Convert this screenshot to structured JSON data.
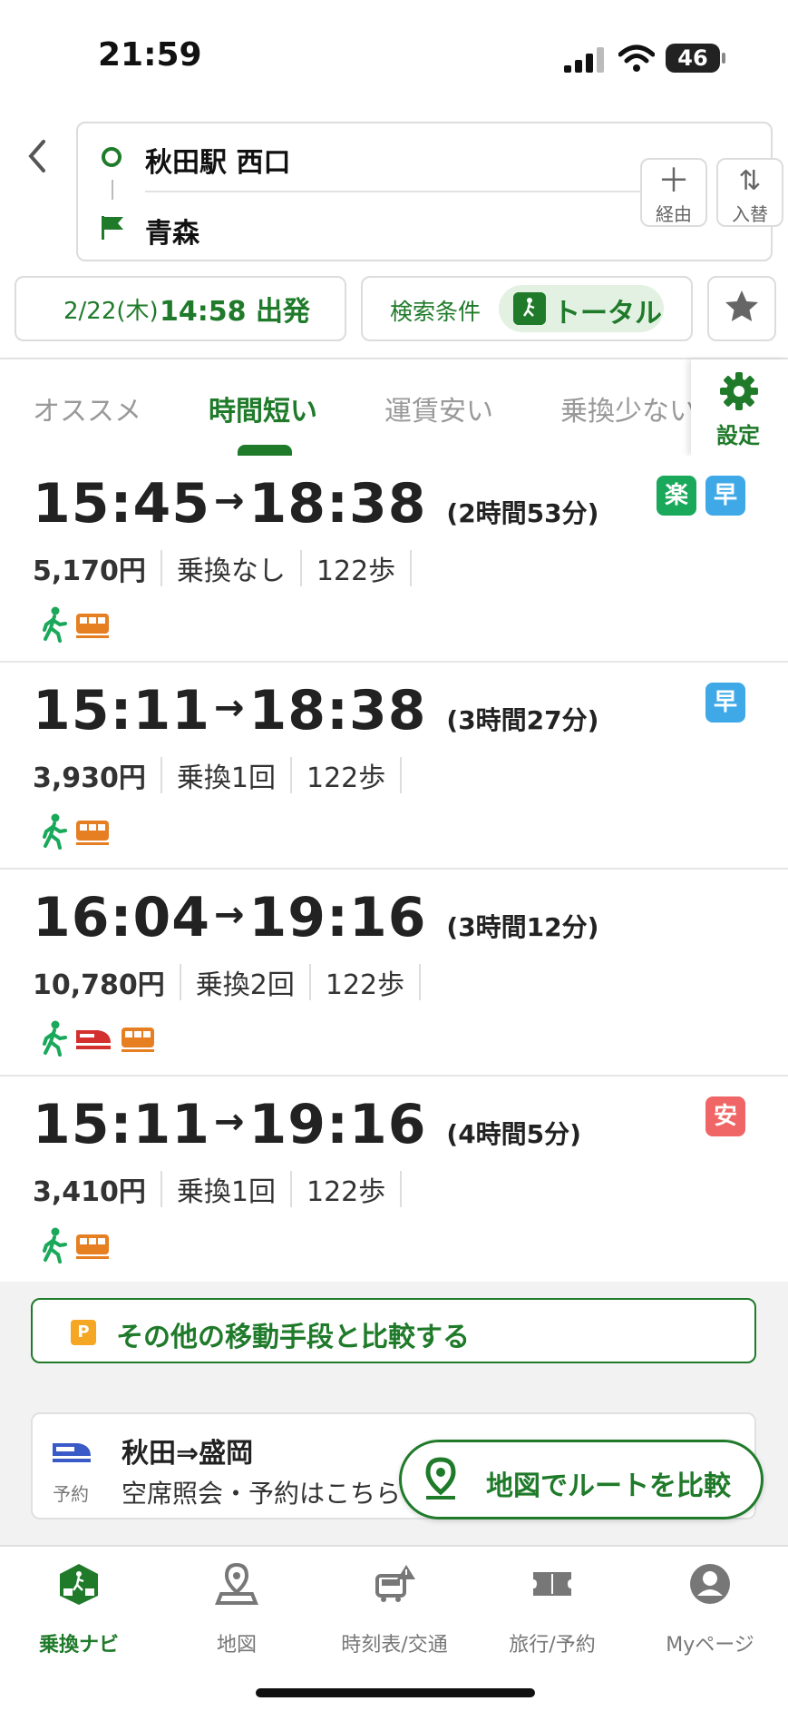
{
  "status_bar": {
    "time": "21:59",
    "battery": "46"
  },
  "route": {
    "origin": "秋田駅 西口",
    "destination": "青森"
  },
  "buttons": {
    "via": "経由",
    "swap": "入替"
  },
  "search": {
    "date": "2/22(木)",
    "time": "14:58 出発",
    "condition_label": "検索条件",
    "condition_value": "トータル"
  },
  "tabs": [
    {
      "label": "オススメ",
      "active": false
    },
    {
      "label": "時間短い",
      "active": true
    },
    {
      "label": "運賃安い",
      "active": false
    },
    {
      "label": "乗換少ない",
      "active": false
    }
  ],
  "settings_label": "設定",
  "routes": [
    {
      "depart": "15:45",
      "arrive": "18:38",
      "duration": "(2時間53分)",
      "fare": "5,170円",
      "transfers": "乗換なし",
      "walk": "122歩",
      "badges": [
        "楽",
        "早"
      ],
      "modes": [
        "walk",
        "train"
      ]
    },
    {
      "depart": "15:11",
      "arrive": "18:38",
      "duration": "(3時間27分)",
      "fare": "3,930円",
      "transfers": "乗換1回",
      "walk": "122歩",
      "badges": [
        "早"
      ],
      "modes": [
        "walk",
        "train"
      ]
    },
    {
      "depart": "16:04",
      "arrive": "19:16",
      "duration": "(3時間12分)",
      "fare": "10,780円",
      "transfers": "乗換2回",
      "walk": "122歩",
      "badges": [],
      "modes": [
        "walk",
        "shinkansen",
        "train"
      ]
    },
    {
      "depart": "15:11",
      "arrive": "19:16",
      "duration": "(4時間5分)",
      "fare": "3,410円",
      "transfers": "乗換1回",
      "walk": "122歩",
      "badges": [
        "安"
      ],
      "modes": [
        "walk",
        "train"
      ]
    }
  ],
  "compare": {
    "mark": "P",
    "label": "その他の移動手段と比較する"
  },
  "ad": {
    "tag": "予約",
    "title": "秋田⇒盛岡",
    "subtitle": "空席照会・予約はこちら"
  },
  "map_compare": "地図でルートを比較",
  "bottom_nav": [
    {
      "label": "乗換ナビ",
      "icon": "transit-nav-icon",
      "active": true
    },
    {
      "label": "地図",
      "icon": "map-icon",
      "active": false
    },
    {
      "label": "時刻表/交通",
      "icon": "timetable-icon",
      "active": false
    },
    {
      "label": "旅行/予約",
      "icon": "ticket-icon",
      "active": false
    },
    {
      "label": "Myページ",
      "icon": "person-icon",
      "active": false
    }
  ],
  "colors": {
    "brand": "#1f7a2a",
    "raku": "#1aa85a",
    "haya": "#3fa9e8",
    "yasu": "#f06565",
    "train": "#e67e22",
    "shinkansen": "#d32f2f"
  }
}
